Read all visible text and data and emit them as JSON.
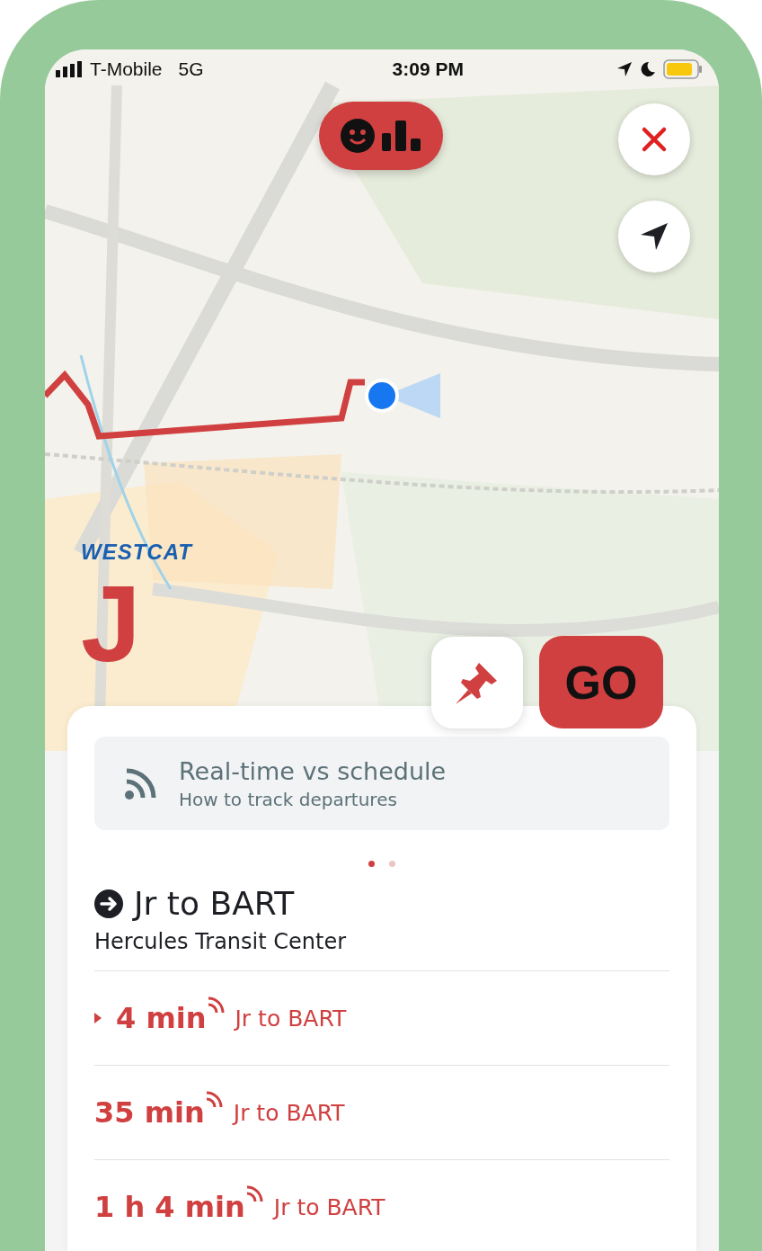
{
  "status_bar": {
    "carrier": "T-Mobile",
    "network": "5G",
    "time": "3:09 PM"
  },
  "map_overlay": {
    "agency_logo": "WESTCAT",
    "route_letter": "J"
  },
  "go_button": {
    "label": "GO"
  },
  "info_card": {
    "title": "Real-time vs schedule",
    "subtitle": "How to track departures"
  },
  "pager": [
    {
      "selected": true
    },
    {
      "selected": false
    }
  ],
  "route": {
    "name": "Jr to BART",
    "stop": "Hercules Transit Center"
  },
  "departures": [
    {
      "time": "4 min",
      "headsign": "Jr to BART",
      "realtime": true,
      "selected": true
    },
    {
      "time": "35 min",
      "headsign": "Jr to BART",
      "realtime": true,
      "selected": false
    },
    {
      "time": "1 h 4 min",
      "headsign": "Jr to BART",
      "realtime": true,
      "selected": false
    }
  ]
}
